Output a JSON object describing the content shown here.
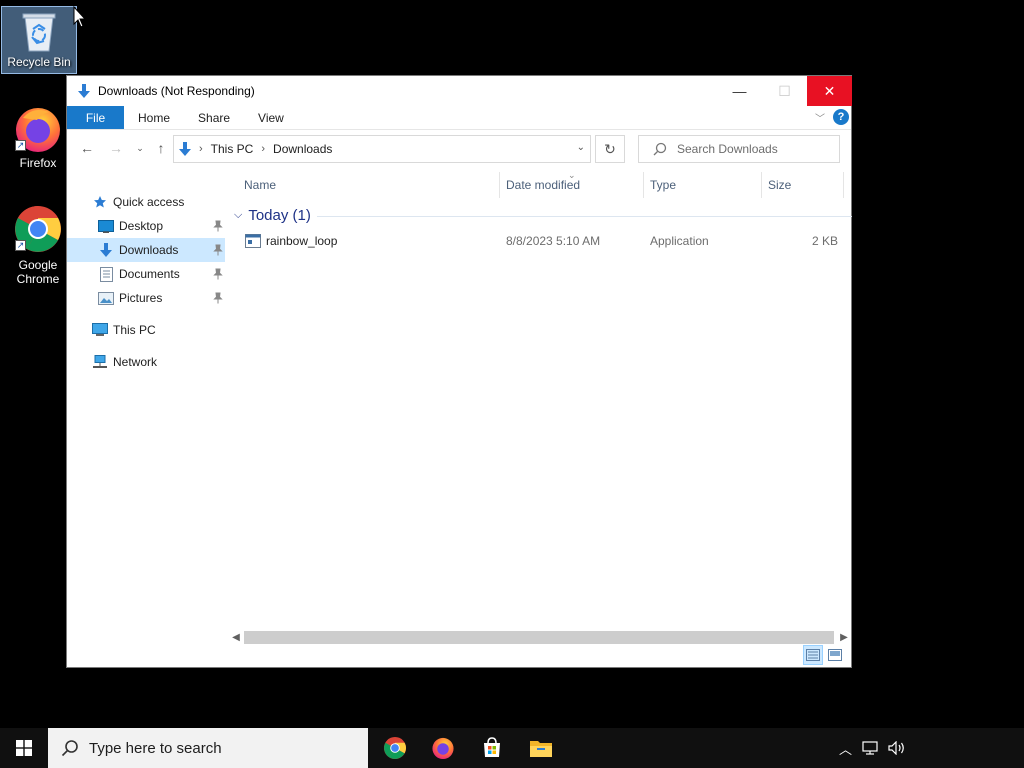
{
  "desktop": {
    "icons": [
      {
        "label": "Recycle Bin",
        "icon": "recycle-bin-icon"
      },
      {
        "label": "Firefox",
        "icon": "firefox-icon"
      },
      {
        "label": "Google Chrome",
        "icon": "chrome-icon"
      }
    ]
  },
  "window": {
    "title": "Downloads (Not Responding)",
    "controls": {
      "minimize": "—",
      "maximize": "☐",
      "close": "✕"
    }
  },
  "ribbon": {
    "tabs": [
      "File",
      "Home",
      "Share",
      "View"
    ],
    "help": "?"
  },
  "address": {
    "crumbs": [
      "This PC",
      "Downloads"
    ],
    "search_placeholder": "Search Downloads"
  },
  "nav_pane": {
    "quick_access": "Quick access",
    "items": [
      {
        "label": "Desktop",
        "pinned": true
      },
      {
        "label": "Downloads",
        "pinned": true,
        "selected": true
      },
      {
        "label": "Documents",
        "pinned": true
      },
      {
        "label": "Pictures",
        "pinned": true
      }
    ],
    "this_pc": "This PC",
    "network": "Network"
  },
  "content": {
    "columns": [
      "Name",
      "Date modified",
      "Type",
      "Size"
    ],
    "group": {
      "title": "Today (1)"
    },
    "files": [
      {
        "name": "rainbow_loop",
        "date_modified": "8/8/2023 5:10 AM",
        "type": "Application",
        "size": "2 KB"
      }
    ]
  },
  "taskbar": {
    "search_placeholder": "Type here to search",
    "apps": [
      "chrome-icon",
      "firefox-icon",
      "store-icon",
      "file-explorer-icon"
    ]
  },
  "colors": {
    "accent": "#1979ca",
    "close_red": "#e81123",
    "selection": "#cce8ff",
    "group_title": "#1e3287"
  }
}
